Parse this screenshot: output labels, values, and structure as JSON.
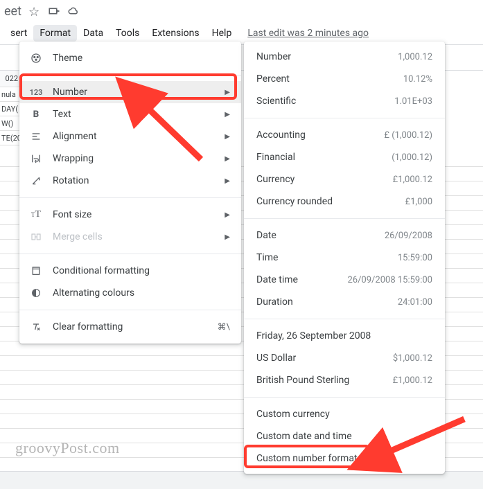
{
  "titlebar": {
    "doc_name_suffix": "eet"
  },
  "menubar": {
    "items": [
      "sert",
      "Format",
      "Data",
      "Tools",
      "Extensions",
      "Help"
    ],
    "last_edit": "Last edit was 2 minutes ago"
  },
  "sheet": {
    "col_header": "022",
    "cells": [
      "nula",
      "DAY(",
      "W()",
      "TE(20"
    ]
  },
  "format_menu": {
    "theme": "Theme",
    "number": "Number",
    "text": "Text",
    "alignment": "Alignment",
    "wrapping": "Wrapping",
    "rotation": "Rotation",
    "font_size": "Font size",
    "merge_cells": "Merge cells",
    "conditional": "Conditional formatting",
    "alternating": "Alternating colours",
    "clear": "Clear formatting",
    "clear_shortcut": "⌘\\"
  },
  "number_submenu": {
    "groups": [
      [
        {
          "label": "Number",
          "example": "1,000.12"
        },
        {
          "label": "Percent",
          "example": "10.12%"
        },
        {
          "label": "Scientific",
          "example": "1.01E+03"
        }
      ],
      [
        {
          "label": "Accounting",
          "example": "£ (1,000.12)"
        },
        {
          "label": "Financial",
          "example": "(1,000.12)"
        },
        {
          "label": "Currency",
          "example": "£1,000.12"
        },
        {
          "label": "Currency rounded",
          "example": "£1,000"
        }
      ],
      [
        {
          "label": "Date",
          "example": "26/09/2008"
        },
        {
          "label": "Time",
          "example": "15:59:00"
        },
        {
          "label": "Date time",
          "example": "26/09/2008 15:59:00"
        },
        {
          "label": "Duration",
          "example": "24:01:00"
        }
      ],
      [
        {
          "label": "Friday, 26 September 2008",
          "example": ""
        },
        {
          "label": "US Dollar",
          "example": "$1,000.12"
        },
        {
          "label": "British Pound Sterling",
          "example": "£1,000.12"
        }
      ],
      [
        {
          "label": "Custom currency",
          "example": ""
        },
        {
          "label": "Custom date and time",
          "example": ""
        },
        {
          "label": "Custom number format",
          "example": ""
        }
      ]
    ]
  },
  "watermark": "groovyPost.com"
}
